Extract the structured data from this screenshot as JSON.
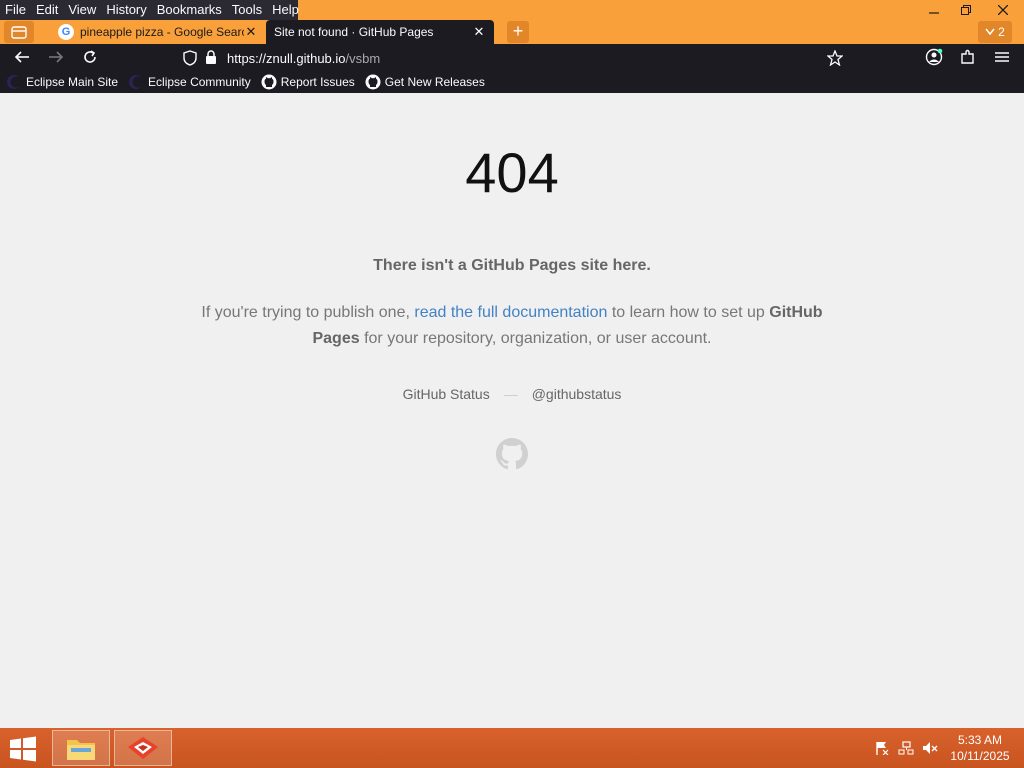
{
  "window": {
    "menu": [
      "File",
      "Edit",
      "View",
      "History",
      "Bookmarks",
      "Tools",
      "Help"
    ],
    "tabs": [
      {
        "label": "pineapple pizza - Google Search",
        "favicon": "google-icon",
        "active": false
      },
      {
        "label": "Site not found · GitHub Pages",
        "favicon": "none",
        "active": true
      }
    ],
    "tab_count": "2"
  },
  "navbar": {
    "url_host": "https://znull.github.io",
    "url_path": "/vsbm"
  },
  "bookmarks": [
    {
      "label": "Eclipse Main Site",
      "icon": "eclipse-icon"
    },
    {
      "label": "Eclipse Community",
      "icon": "eclipse-icon"
    },
    {
      "label": "Report Issues",
      "icon": "github-icon"
    },
    {
      "label": "Get New Releases",
      "icon": "github-icon"
    }
  ],
  "page": {
    "code": "404",
    "headline": "There isn't a GitHub Pages site here.",
    "para_pre": "If you're trying to publish one, ",
    "para_link": "read the full documentation",
    "para_mid": " to learn how to set up ",
    "para_bold": "GitHub Pages",
    "para_post": " for your repository, organization, or user account.",
    "status_link": "GitHub Status",
    "separator": "—",
    "twitter_link": "@githubstatus"
  },
  "taskbar": {
    "time": "5:33 AM",
    "date": "10/11/2025"
  },
  "colors": {
    "accent": "#f9a03a",
    "chrome_dark": "#1c1b22",
    "link": "#4183c4",
    "taskbar": "#d9622c"
  }
}
